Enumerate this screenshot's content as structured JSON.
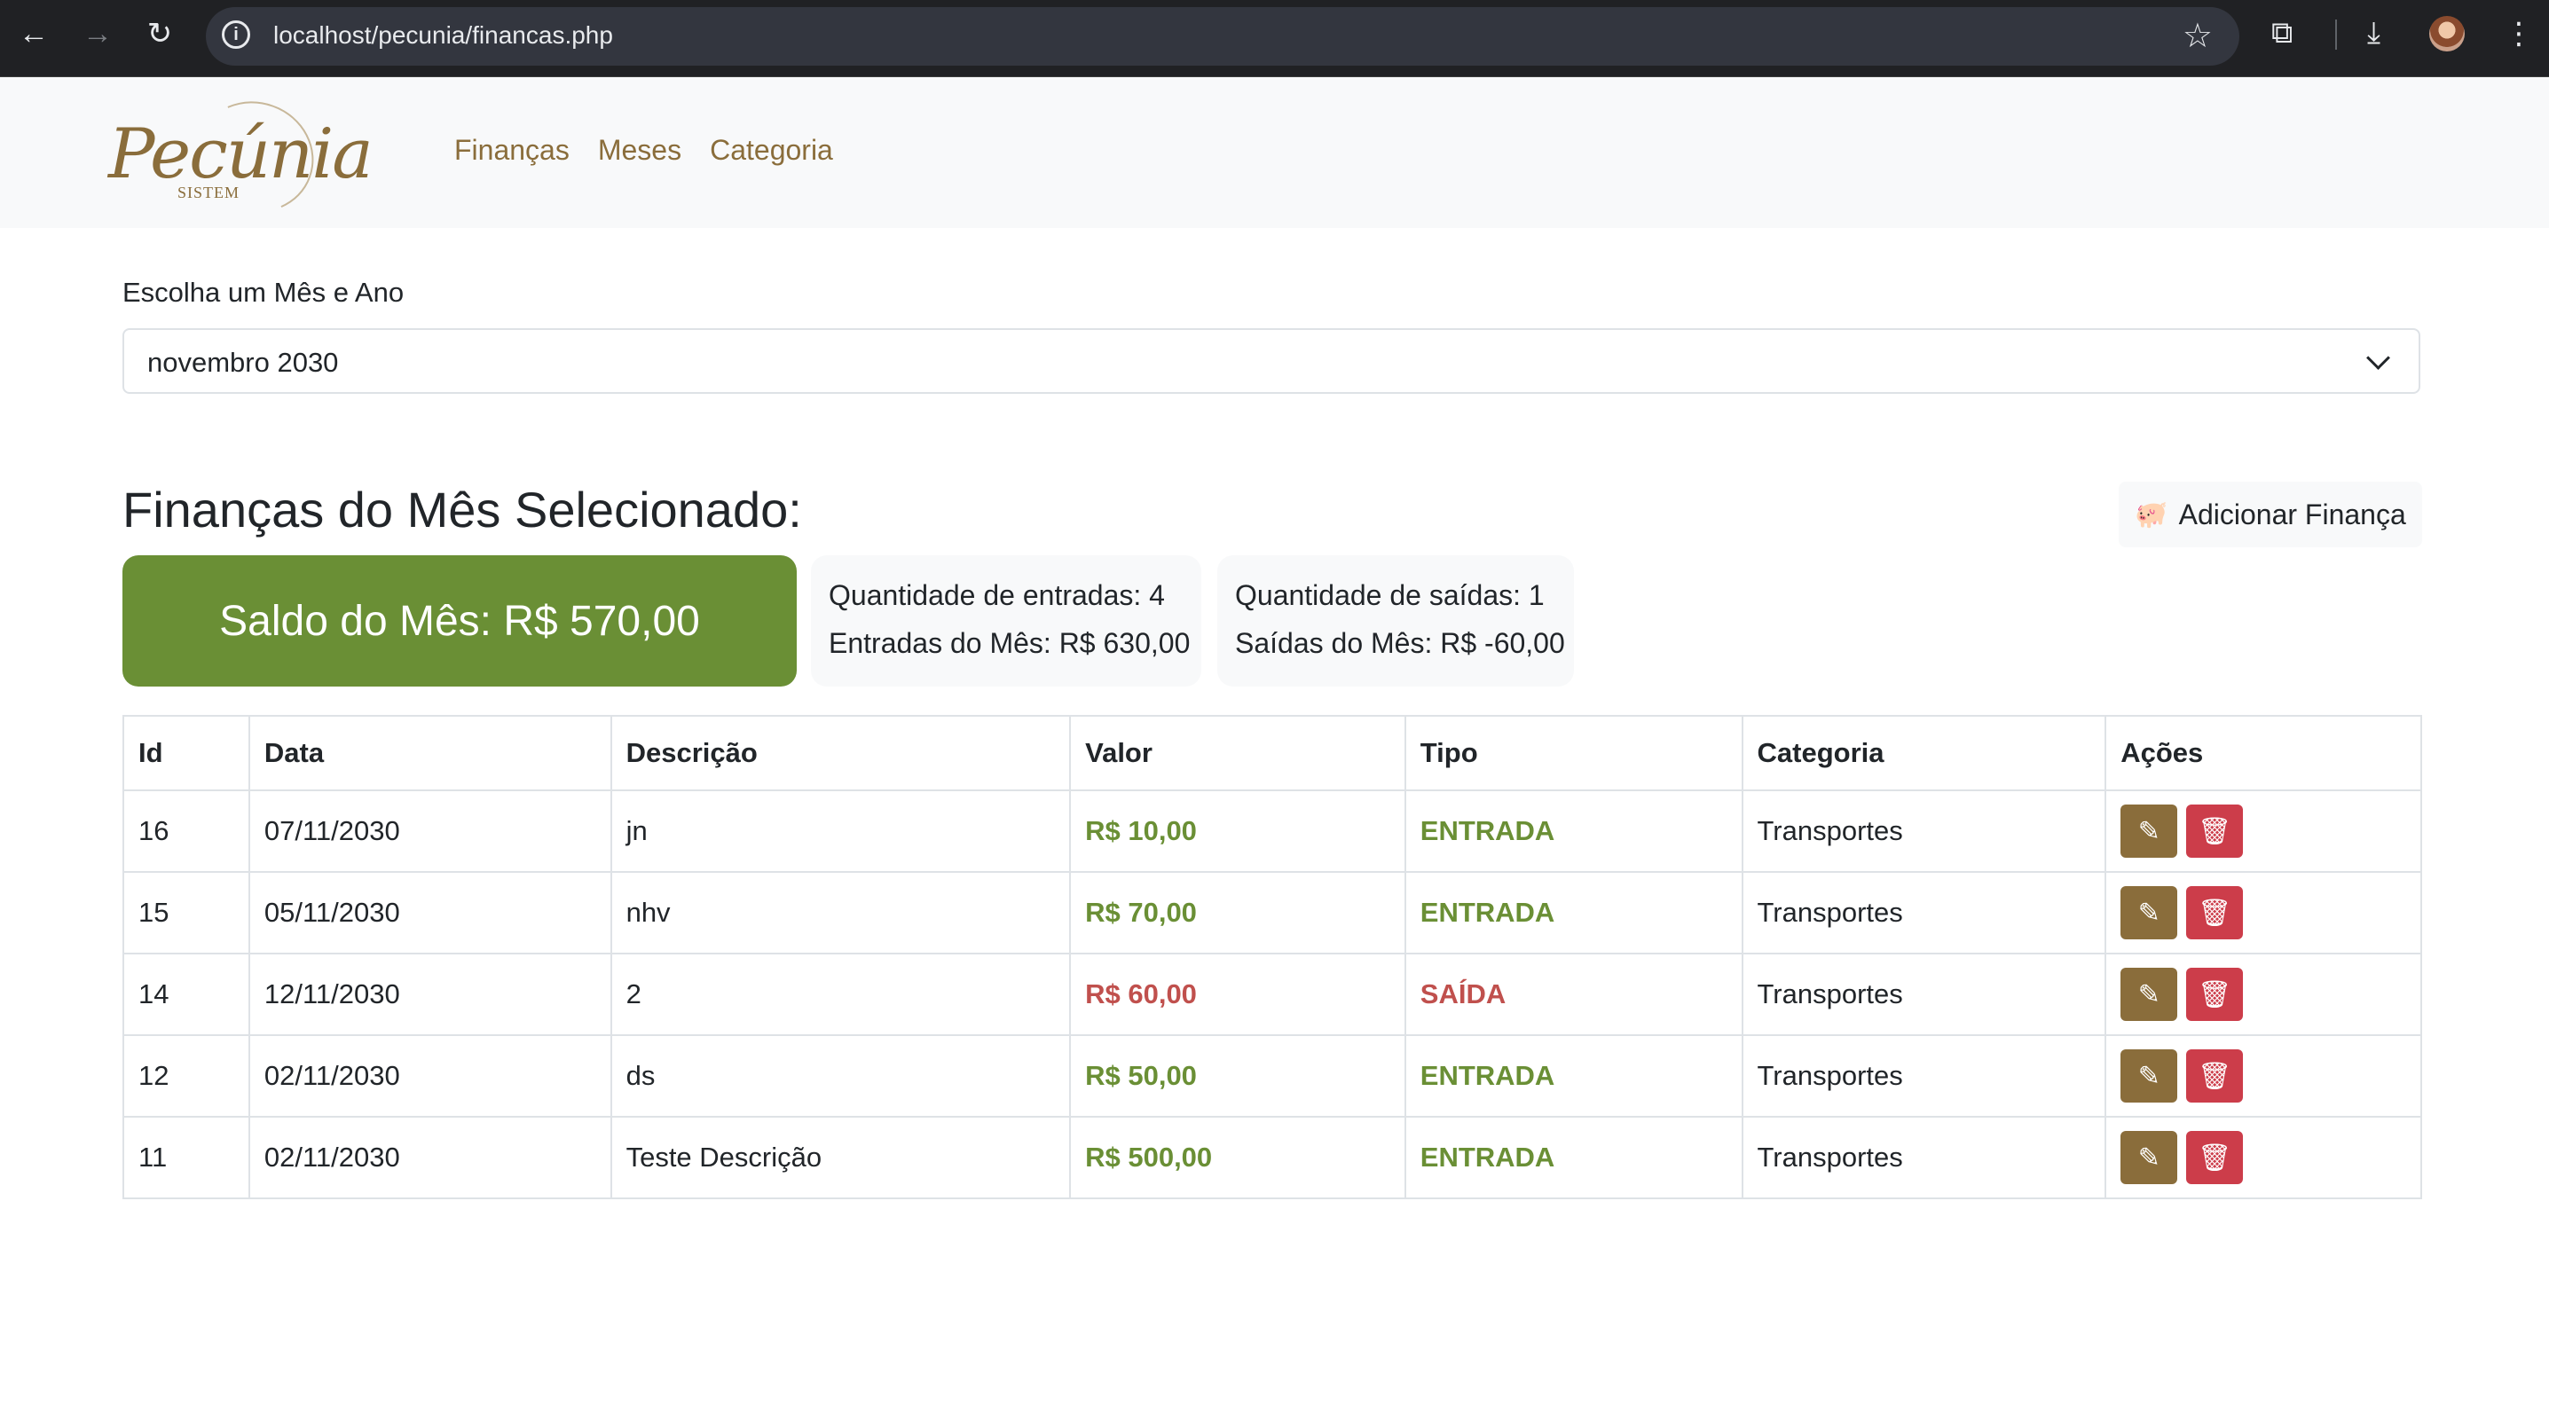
{
  "browser": {
    "url": "localhost/pecunia/financas.php"
  },
  "brand": {
    "name": "Pecúnia",
    "sub": "SISTEM"
  },
  "nav": {
    "items": [
      "Finanças",
      "Meses",
      "Categoria"
    ]
  },
  "picker": {
    "label": "Escolha um Mês e Ano",
    "value": "novembro 2030"
  },
  "page": {
    "title": "Finanças do Mês Selecionado:",
    "add_button": "Adicionar Finança"
  },
  "summary": {
    "saldo": "Saldo do Mês: R$ 570,00",
    "entradas_qtd": "Quantidade de entradas: 4",
    "entradas_total": "Entradas do Mês: R$ 630,00",
    "saidas_qtd": "Quantidade de saídas: 1",
    "saidas_total": "Saídas do Mês: R$ -60,00"
  },
  "table": {
    "headers": [
      "Id",
      "Data",
      "Descrição",
      "Valor",
      "Tipo",
      "Categoria",
      "Ações"
    ],
    "rows": [
      {
        "id": "16",
        "data": "07/11/2030",
        "descricao": "jn",
        "valor": "R$ 10,00",
        "tipo": "ENTRADA",
        "categoria": "Transportes"
      },
      {
        "id": "15",
        "data": "05/11/2030",
        "descricao": "nhv",
        "valor": "R$ 70,00",
        "tipo": "ENTRADA",
        "categoria": "Transportes"
      },
      {
        "id": "14",
        "data": "12/11/2030",
        "descricao": "2",
        "valor": "R$ 60,00",
        "tipo": "SAÍDA",
        "categoria": "Transportes"
      },
      {
        "id": "12",
        "data": "02/11/2030",
        "descricao": "ds",
        "valor": "R$ 50,00",
        "tipo": "ENTRADA",
        "categoria": "Transportes"
      },
      {
        "id": "11",
        "data": "02/11/2030",
        "descricao": "Teste Descrição",
        "valor": "R$ 500,00",
        "tipo": "ENTRADA",
        "categoria": "Transportes"
      }
    ]
  },
  "colors": {
    "accent": "#8a6d3b",
    "positive": "#6a8f35",
    "negative": "#c0504d",
    "delete": "#cc3d4a"
  }
}
